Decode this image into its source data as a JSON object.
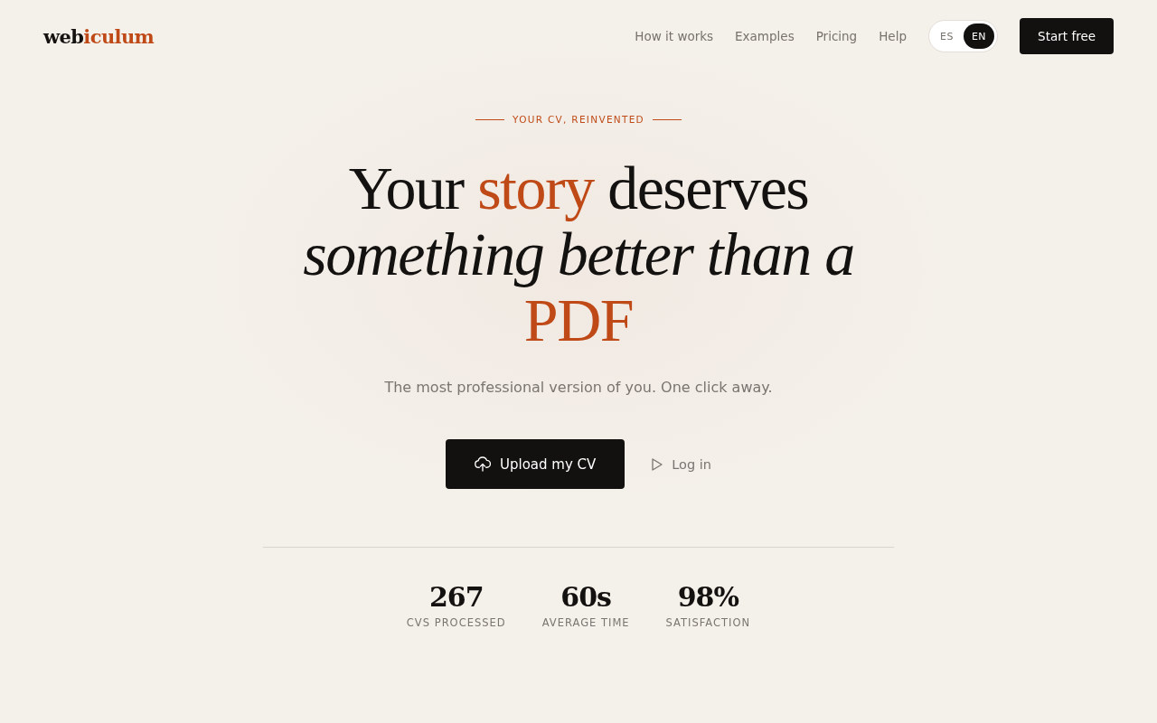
{
  "logo": {
    "parts": [
      {
        "text": "web",
        "accent": false
      },
      {
        "text": "iculum",
        "accent": true
      }
    ]
  },
  "nav": {
    "links": [
      "How it works",
      "Examples",
      "Pricing",
      "Help"
    ],
    "languages": [
      {
        "label": "ES",
        "selected": false
      },
      {
        "label": "EN",
        "selected": true
      }
    ],
    "cta": "Start free"
  },
  "hero": {
    "eyebrow": "YOUR CV, REINVENTED",
    "headline": {
      "lines": [
        [
          {
            "text": "Your ",
            "kind": "plain"
          },
          {
            "text": "story",
            "kind": "accent"
          },
          {
            "text": " deserves",
            "kind": "plain"
          }
        ],
        [
          {
            "text": "something better than a",
            "kind": "italic"
          }
        ],
        [
          {
            "text": "PDF",
            "kind": "accent"
          }
        ]
      ]
    },
    "subtitle": "The most professional version of you. One click away.",
    "primary_button": "Upload my CV",
    "secondary_button": "Log in"
  },
  "stats": [
    {
      "value": "267",
      "label": "CVS PROCESSED"
    },
    {
      "value": "60s",
      "label": "AVERAGE TIME"
    },
    {
      "value": "98%",
      "label": "SATISFACTION"
    }
  ]
}
